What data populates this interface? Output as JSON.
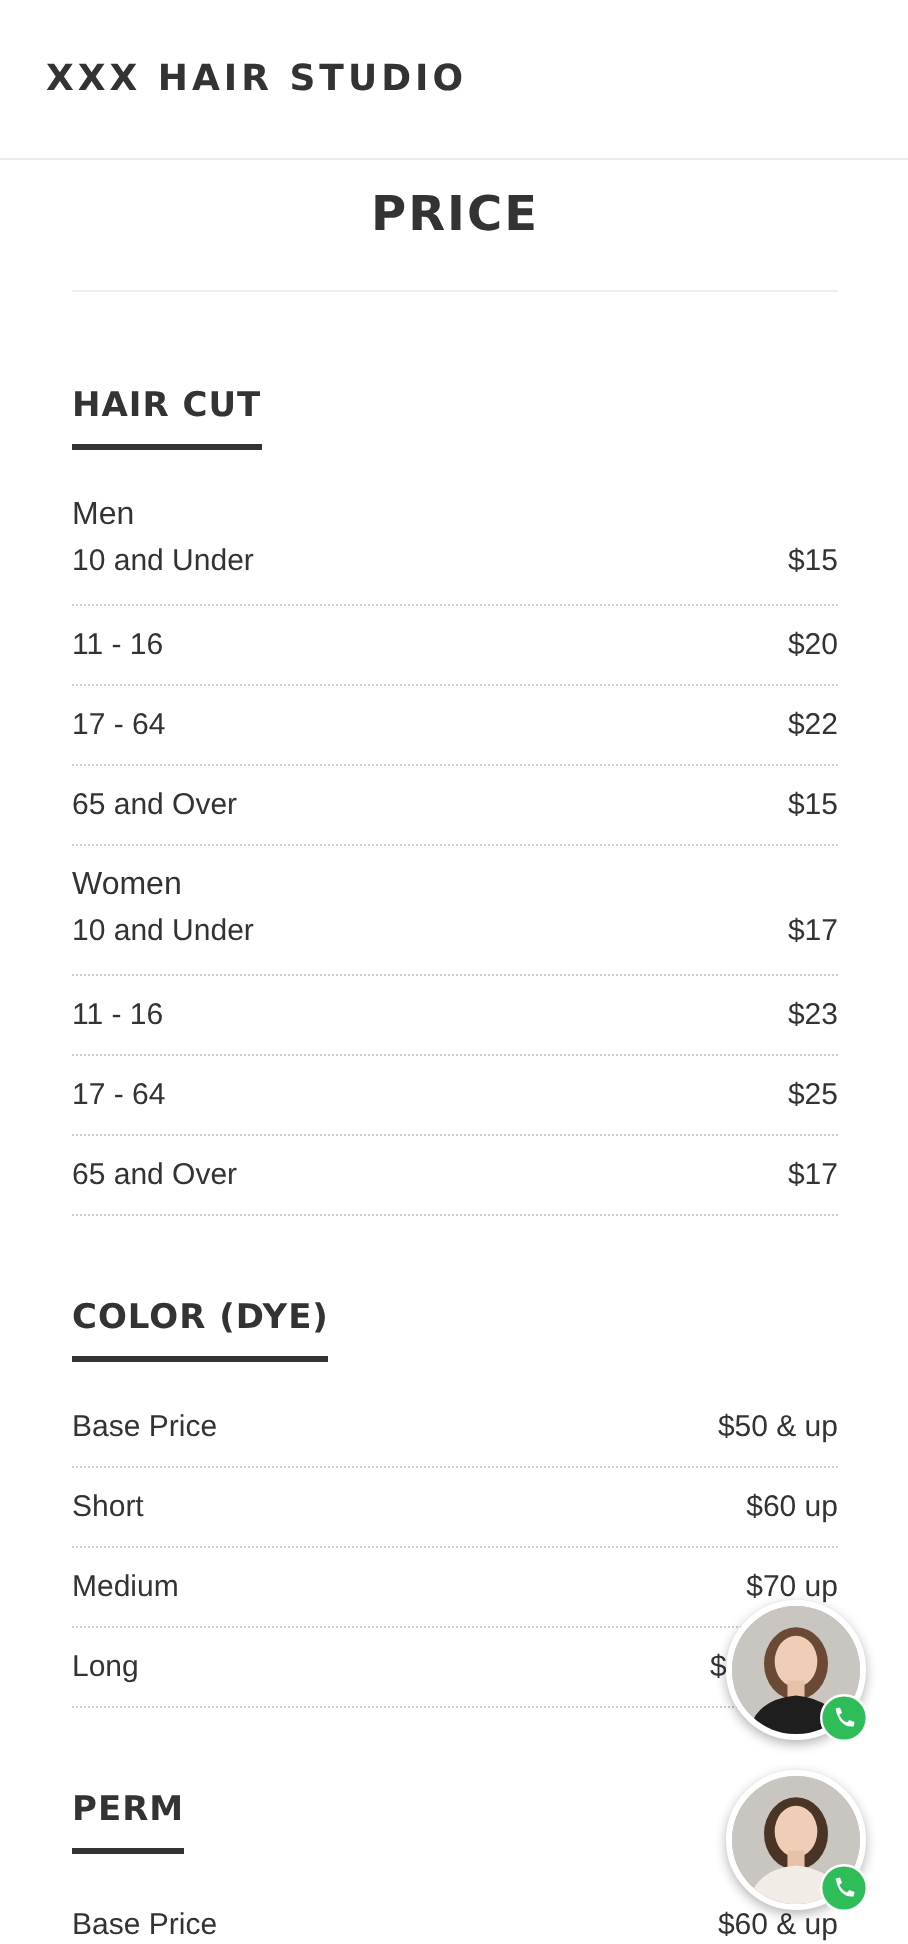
{
  "header": {
    "title": "XXX HAIR STUDIO"
  },
  "page_title": "PRICE",
  "sections": [
    {
      "heading": "HAIR CUT",
      "groups": [
        {
          "label": "Men",
          "rows": [
            {
              "item": "10 and Under",
              "price": "$15"
            },
            {
              "item": "11 - 16",
              "price": "$20"
            },
            {
              "item": "17 - 64",
              "price": "$22"
            },
            {
              "item": "65 and Over",
              "price": "$15"
            }
          ]
        },
        {
          "label": "Women",
          "rows": [
            {
              "item": "10 and Under",
              "price": "$17"
            },
            {
              "item": "11 - 16",
              "price": "$23"
            },
            {
              "item": "17 - 64",
              "price": "$25"
            },
            {
              "item": "65 and Over",
              "price": "$17"
            }
          ]
        }
      ]
    },
    {
      "heading": "COLOR (DYE)",
      "groups": [
        {
          "rows": [
            {
              "item": "Base Price",
              "price": "$50 & up"
            },
            {
              "item": "Short",
              "price": "$60 up"
            },
            {
              "item": "Medium",
              "price": "$70 up"
            },
            {
              "item": "Long",
              "price": "$",
              "covered": true
            }
          ]
        }
      ]
    },
    {
      "heading": "PERM",
      "groups": [
        {
          "rows": [
            {
              "item": "Base Price",
              "price": "$60 & up"
            }
          ]
        }
      ]
    }
  ]
}
